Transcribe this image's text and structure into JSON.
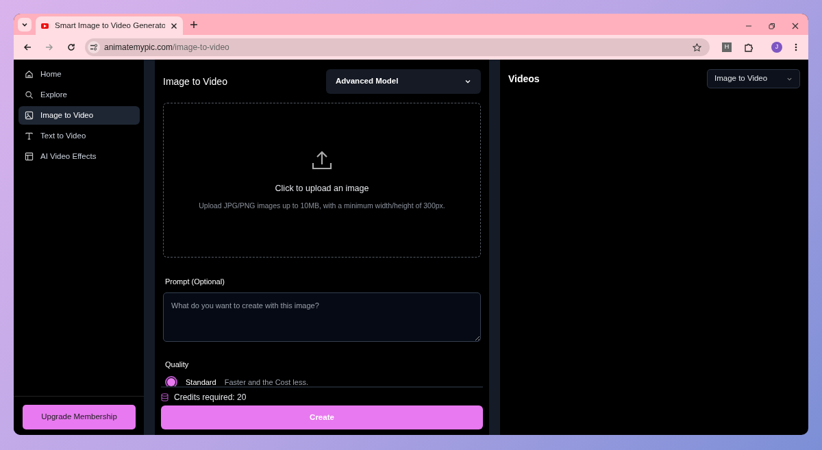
{
  "browser": {
    "tab_title": "Smart Image to Video Generato",
    "url_host": "animatemypic.com",
    "url_path": "/image-to-video",
    "profile_initial": "J",
    "extension_letter": "H"
  },
  "sidebar": {
    "items": [
      {
        "label": "Home",
        "selected": false
      },
      {
        "label": "Explore",
        "selected": false
      },
      {
        "label": "Image to Video",
        "selected": true
      },
      {
        "label": "Text to Video",
        "selected": false
      },
      {
        "label": "AI Video Effects",
        "selected": false
      }
    ],
    "upgrade_button": "Upgrade Membership"
  },
  "editor": {
    "title": "Image to Video",
    "model_select": "Advanced Model",
    "upload": {
      "title": "Click to upload an image",
      "hint": "Upload JPG/PNG images up to 10MB, with a minimum width/height of 300px."
    },
    "prompt": {
      "label": "Prompt (Optional)",
      "placeholder": "What do you want to create with this image?"
    },
    "quality": {
      "label": "Quality",
      "options": [
        {
          "name": "Standard",
          "description": "Faster and the Cost less.",
          "selected": true
        }
      ]
    },
    "credits": "Credits required: 20",
    "create_button": "Create"
  },
  "videos": {
    "title": "Videos",
    "filter_select": "Image to Video"
  }
}
